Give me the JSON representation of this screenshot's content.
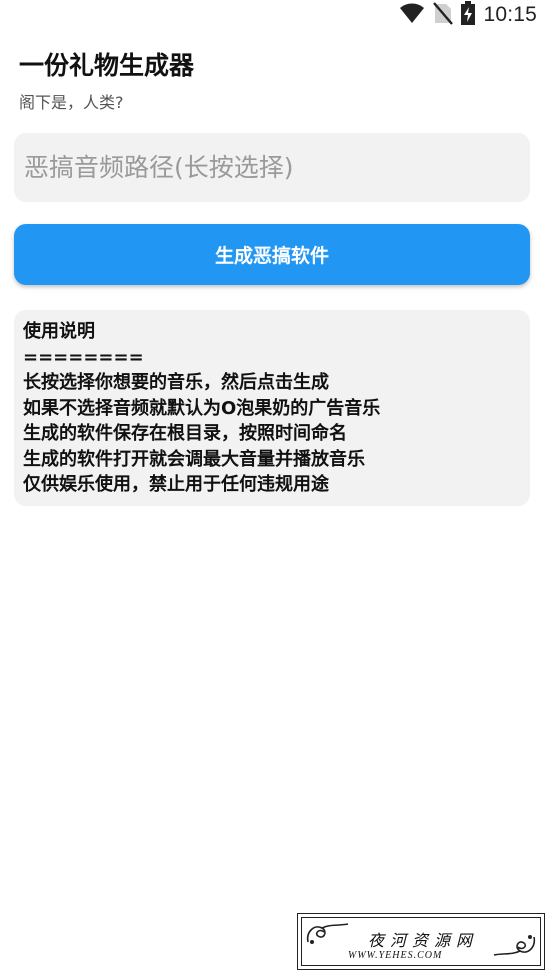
{
  "status_bar": {
    "time": "10:15",
    "icons": [
      "wifi-icon",
      "no-sim-icon",
      "battery-charging-icon"
    ]
  },
  "header": {
    "title": "一份礼物生成器",
    "subtitle": "阁下是，人类?"
  },
  "audio_input": {
    "value": "",
    "placeholder": "恶搞音频路径(长按选择)"
  },
  "generate_button": {
    "label": "生成恶搞软件",
    "color": "#2196F3"
  },
  "instructions": {
    "lines": [
      "使用说明",
      "========",
      "长按选择你想要的音乐，然后点击生成",
      "如果不选择音频就默认为O泡果奶的广告音乐",
      "生成的软件保存在根目录，按照时间命名",
      "生成的软件打开就会调最大音量并播放音乐",
      "仅供娱乐使用，禁止用于任何违规用途"
    ]
  },
  "watermark": {
    "cn": "夜河资源网",
    "en": "WWW.YEHES.COM"
  }
}
